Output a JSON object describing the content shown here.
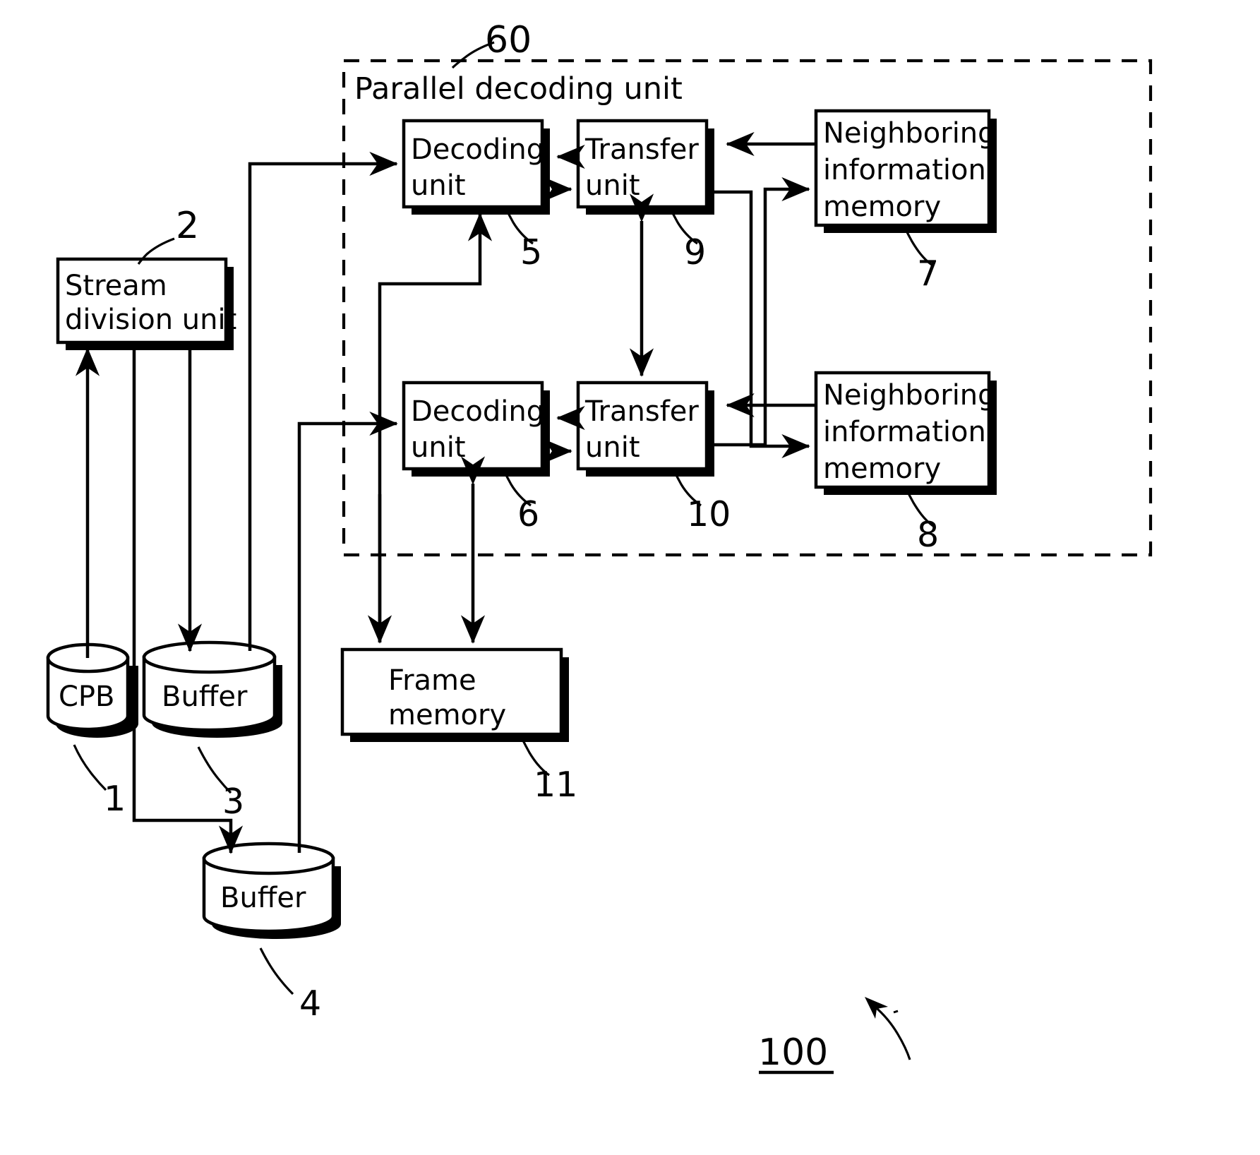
{
  "figure": {
    "type": "block-diagram",
    "overall_ref": "100",
    "dashed_group": {
      "label": "Parallel decoding unit",
      "ref": "60"
    }
  },
  "blocks": [
    {
      "id": "stream_division_unit",
      "label_lines": [
        "Stream",
        "division unit"
      ],
      "ref": "2",
      "shape": "rect"
    },
    {
      "id": "decoding_unit_1",
      "label_lines": [
        "Decoding",
        "unit"
      ],
      "ref": "5",
      "shape": "rect"
    },
    {
      "id": "transfer_unit_1",
      "label_lines": [
        "Transfer",
        "unit"
      ],
      "ref": "9",
      "shape": "rect"
    },
    {
      "id": "neighboring_information_memory_1",
      "label_lines": [
        "Neighboring",
        "information",
        "memory"
      ],
      "ref": "7",
      "shape": "rect"
    },
    {
      "id": "decoding_unit_2",
      "label_lines": [
        "Decoding",
        "unit"
      ],
      "ref": "6",
      "shape": "rect"
    },
    {
      "id": "transfer_unit_2",
      "label_lines": [
        "Transfer",
        "unit"
      ],
      "ref": "10",
      "shape": "rect"
    },
    {
      "id": "neighboring_information_memory_2",
      "label_lines": [
        "Neighboring",
        "information",
        "memory"
      ],
      "ref": "8",
      "shape": "rect"
    },
    {
      "id": "frame_memory",
      "label_lines": [
        "Frame",
        "memory"
      ],
      "ref": "11",
      "shape": "rect"
    },
    {
      "id": "cpb",
      "label_lines": [
        "CPB"
      ],
      "ref": "1",
      "shape": "cylinder"
    },
    {
      "id": "buffer_1",
      "label_lines": [
        "Buffer"
      ],
      "ref": "3",
      "shape": "cylinder"
    },
    {
      "id": "buffer_2",
      "label_lines": [
        "Buffer"
      ],
      "ref": "4",
      "shape": "cylinder"
    }
  ],
  "labels": {
    "parallel_decoding_unit": "Parallel decoding unit",
    "stream_division_line1": "Stream",
    "stream_division_line2": "division unit",
    "decoding_line1": "Decoding",
    "decoding_line2": "unit",
    "transfer_line1": "Transfer",
    "transfer_line2": "unit",
    "neighboring_line1": "Neighboring",
    "neighboring_line2": "information",
    "neighboring_line3": "memory",
    "frame_line1": "Frame",
    "frame_line2": "memory",
    "cpb": "CPB",
    "buffer": "Buffer"
  },
  "refs": {
    "r60": "60",
    "r2": "2",
    "r5": "5",
    "r9": "9",
    "r7": "7",
    "r6": "6",
    "r10": "10",
    "r8": "8",
    "r11": "11",
    "r1": "1",
    "r3": "3",
    "r4": "4",
    "r100": "100"
  },
  "colors": {
    "stroke": "#000000",
    "fill": "#ffffff",
    "background": "#ffffff"
  }
}
